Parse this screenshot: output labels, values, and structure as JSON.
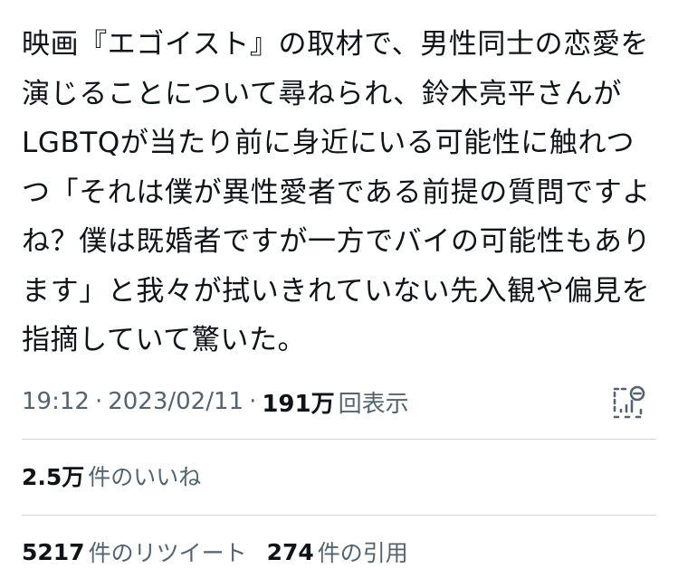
{
  "tweet": {
    "lines": [
      "映画『エゴイスト』の取材で、男性同士の恋愛を",
      "演じることについて尋ねられ、鈴木亮平さんが",
      "LGBTQが当たり前に身近にいる可能性に触れつ",
      "つ「それは僕が異性愛者である前提の質問ですよ",
      "ね？僕は既婚者ですが一方でバイの可能性もあり",
      "ます」と我々が拭いきれていない先入観や偏見を",
      "指摘していて驚いた。"
    ]
  },
  "meta": {
    "time": "19:12",
    "separator": "·",
    "date": "2023/02/11",
    "views_count": "191万",
    "views_label": "回表示"
  },
  "icons": {
    "analytics": "analytics-icon"
  },
  "stats": {
    "likes_count": "2.5万",
    "likes_label": "件のいいね",
    "retweets_count": "5217",
    "retweets_label": "件のリツイート",
    "quotes_count": "274",
    "quotes_label": "件の引用"
  },
  "colors": {
    "text": "#0f1419",
    "secondary": "#536471",
    "divider": "#cfd9de"
  }
}
